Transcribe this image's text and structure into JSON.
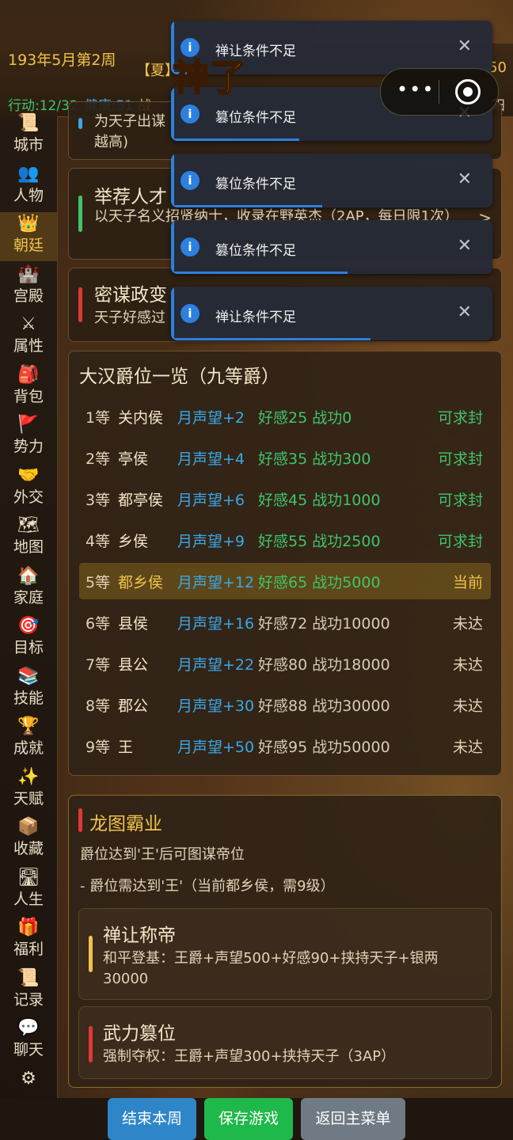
{
  "header": {
    "date": "193年5月第2周",
    "season": "【夏】",
    "right_top": "50",
    "action_points": "行动:12/32",
    "health": "健康:51",
    "war_prefix": "战",
    "right_bottom": "阳"
  },
  "brand_text": "神了",
  "capsule": {
    "dots": "•••"
  },
  "sidebar": {
    "items": [
      {
        "icon": "📜",
        "label": "城市"
      },
      {
        "icon": "👥",
        "label": "人物"
      },
      {
        "icon": "👑",
        "label": "朝廷"
      },
      {
        "icon": "🏰",
        "label": "宫殿"
      },
      {
        "icon": "⚔",
        "label": "属性"
      },
      {
        "icon": "🎒",
        "label": "背包"
      },
      {
        "icon": "🚩",
        "label": "势力"
      },
      {
        "icon": "🤝",
        "label": "外交"
      },
      {
        "icon": "🗺",
        "label": "地图"
      },
      {
        "icon": "🏠",
        "label": "家庭"
      },
      {
        "icon": "🎯",
        "label": "目标"
      },
      {
        "icon": "📚",
        "label": "技能"
      },
      {
        "icon": "🏆",
        "label": "成就"
      },
      {
        "icon": "✨",
        "label": "天赋"
      },
      {
        "icon": "📦",
        "label": "收藏"
      },
      {
        "icon": "🛣",
        "label": "人生"
      },
      {
        "icon": "🎁",
        "label": "福利"
      },
      {
        "icon": "📜",
        "label": "记录"
      },
      {
        "icon": "💬",
        "label": "聊天"
      },
      {
        "icon": "⚙",
        "label": ""
      }
    ],
    "active": "朝廷"
  },
  "actions": [
    {
      "title": "",
      "desc": "为天子出谋\n越高)",
      "color": "#39a7e8"
    },
    {
      "title": "举荐人才",
      "desc": "以天子名义招贤纳士，收录在野英杰（2AP，每日限1次）",
      "color": "#3ec46d"
    },
    {
      "title": "密谋政变",
      "desc": "天子好感过",
      "color": "#e03838"
    }
  ],
  "toasts": [
    {
      "msg": "禅让条件不足",
      "progress": 0.1
    },
    {
      "msg": "篡位条件不足",
      "progress": 0.4
    },
    {
      "msg": "篡位条件不足",
      "progress": 0.47
    },
    {
      "msg": "篡位条件不足",
      "progress": 0.55
    },
    {
      "msg": "禅让条件不足",
      "progress": 0.62
    }
  ],
  "ranks": {
    "title": "大汉爵位一览（九等爵）",
    "rows": [
      {
        "lvl": "1等",
        "name": "关内侯",
        "rep": "月声望+2",
        "req": "好感25 战功0",
        "status": "可求封",
        "state": "ok"
      },
      {
        "lvl": "2等",
        "name": "亭侯",
        "rep": "月声望+4",
        "req": "好感35 战功300",
        "status": "可求封",
        "state": "ok"
      },
      {
        "lvl": "3等",
        "name": "都亭侯",
        "rep": "月声望+6",
        "req": "好感45 战功1000",
        "status": "可求封",
        "state": "ok"
      },
      {
        "lvl": "4等",
        "name": "乡侯",
        "rep": "月声望+9",
        "req": "好感55 战功2500",
        "status": "可求封",
        "state": "ok"
      },
      {
        "lvl": "5等",
        "name": "都乡侯",
        "rep": "月声望+12",
        "req": "好感65 战功5000",
        "status": "当前",
        "state": "cur"
      },
      {
        "lvl": "6等",
        "name": "县侯",
        "rep": "月声望+16",
        "req": "好感72 战功10000",
        "status": "未达",
        "state": "no"
      },
      {
        "lvl": "7等",
        "name": "县公",
        "rep": "月声望+22",
        "req": "好感80 战功18000",
        "status": "未达",
        "state": "no"
      },
      {
        "lvl": "8等",
        "name": "郡公",
        "rep": "月声望+30",
        "req": "好感88 战功30000",
        "status": "未达",
        "state": "no"
      },
      {
        "lvl": "9等",
        "name": "王",
        "rep": "月声望+50",
        "req": "好感95 战功50000",
        "status": "未达",
        "state": "no"
      }
    ]
  },
  "hegemony": {
    "title": "龙图霸业",
    "line1": "爵位达到'王'后可图谋帝位",
    "line2": "- 爵位需达到'王'（当前都乡侯，需9级）",
    "options": [
      {
        "title": "禅让称帝",
        "desc": "和平登基：王爵+声望500+好感90+挟持天子+银两30000",
        "color": "#f0c24a"
      },
      {
        "title": "武力篡位",
        "desc": "强制夺权：王爵+声望300+挟持天子（3AP）",
        "color": "#e03838"
      }
    ]
  },
  "buttons": {
    "end_week": "结束本周",
    "save": "保存游戏",
    "back": "返回主菜单"
  }
}
